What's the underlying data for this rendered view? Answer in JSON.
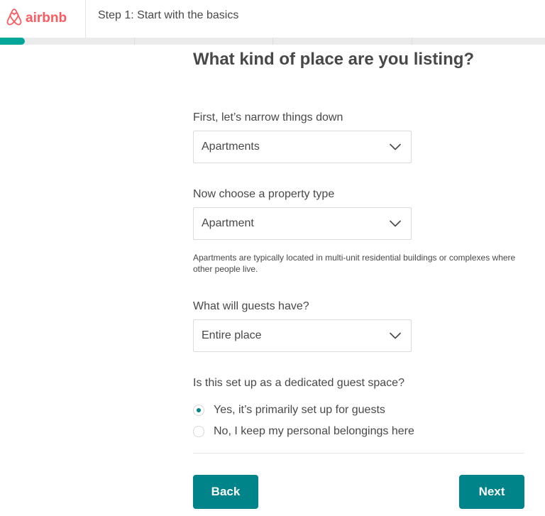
{
  "brand": {
    "name": "airbnb",
    "color": "#FF5A5F"
  },
  "header": {
    "step_title": "Step 1: Start with the basics"
  },
  "progress": {
    "fraction": 0.045,
    "accent": "#00A699"
  },
  "main": {
    "title": "What kind of place are you listing?",
    "category": {
      "label": "First, let’s narrow things down",
      "value": "Apartments"
    },
    "property_type": {
      "label": "Now choose a property type",
      "value": "Apartment",
      "helper": "Apartments are typically located in multi-unit residential buildings or complexes where other people live."
    },
    "guest_access": {
      "label": "What will guests have?",
      "value": "Entire place"
    },
    "dedicated": {
      "question": "Is this set up as a dedicated guest space?",
      "options": [
        {
          "label": "Yes, it’s primarily set up for guests",
          "selected": true
        },
        {
          "label": "No, I keep my personal belongings here",
          "selected": false
        }
      ]
    }
  },
  "footer": {
    "back_label": "Back",
    "next_label": "Next",
    "button_color": "#008489"
  },
  "icons": {
    "logo": "airbnb-logo-icon",
    "dropdown": "chevron-down-icon"
  }
}
